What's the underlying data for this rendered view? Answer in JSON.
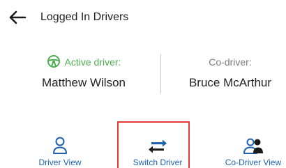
{
  "header": {
    "title": "Logged In Drivers"
  },
  "drivers": {
    "active": {
      "role_label": "Active driver:",
      "name": "Matthew Wilson"
    },
    "co": {
      "role_label": "Co-driver:",
      "name": "Bruce McArthur"
    }
  },
  "nav": {
    "items": [
      {
        "label": "Driver View",
        "icon": "person-icon"
      },
      {
        "label": "Switch Driver",
        "icon": "swap-arrows-icon",
        "highlighted": true
      },
      {
        "label": "Co-Driver View",
        "icon": "two-people-icon"
      }
    ]
  },
  "colors": {
    "active_green": "#4caf50",
    "nav_blue": "#2060b0",
    "highlight_red": "#e53935",
    "co_label_gray": "#7a7a7a"
  }
}
